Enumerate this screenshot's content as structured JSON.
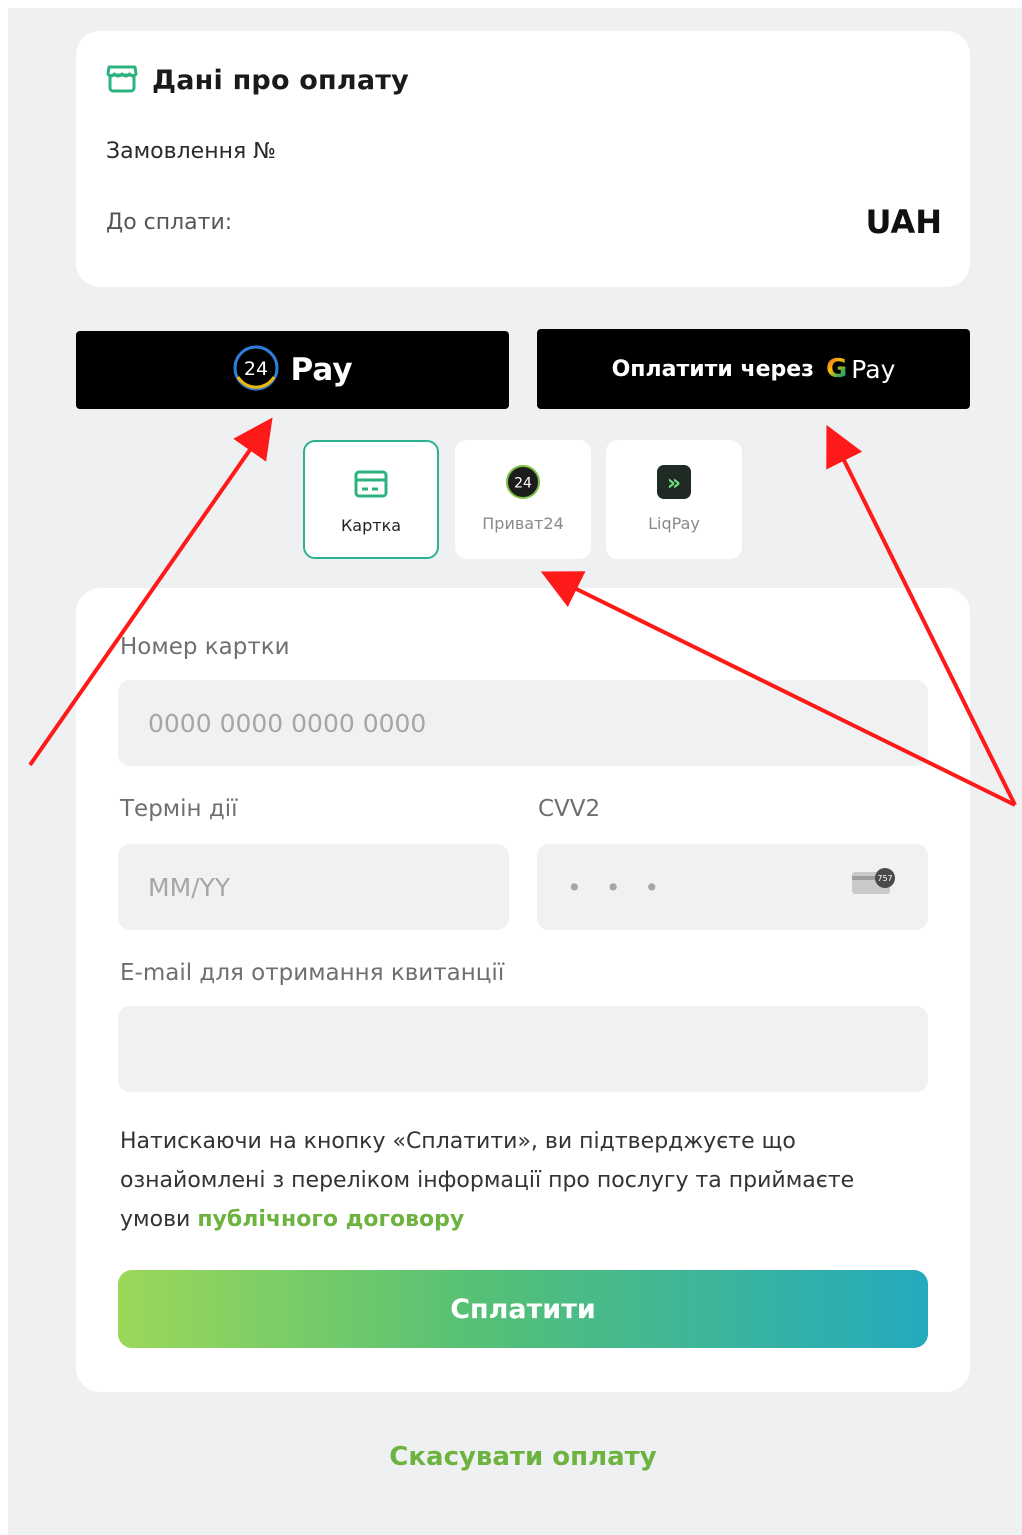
{
  "payment_info": {
    "title": "Дані про оплату",
    "order_label": "Замовлення №",
    "amount_label": "До сплати:",
    "currency": "UAH"
  },
  "quick_pay": {
    "pay24_badge": "24",
    "pay24_label": "Pay",
    "gpay_prefix": "Оплатити через",
    "gpay_g": "G",
    "gpay_label": "Pay"
  },
  "methods": [
    {
      "label": "Картка",
      "icon": "card-icon",
      "active": true
    },
    {
      "label": "Приват24",
      "icon": "privat24-icon",
      "badge": "24",
      "active": false
    },
    {
      "label": "LiqPay",
      "icon": "liqpay-icon",
      "badge": "»",
      "active": false
    }
  ],
  "form": {
    "card_number_label": "Номер картки",
    "card_number_placeholder": "0000 0000 0000 0000",
    "expiry_label": "Термін дії",
    "expiry_placeholder": "MM/YY",
    "cvv_label": "CVV2",
    "cvv_placeholder": "• • •",
    "cvv_hint_text": "757",
    "email_label": "E-mail для отримання квитанції",
    "email_placeholder": "",
    "consent_text": "Натискаючи на кнопку «Сплатити», ви підтверджуєте що ознайомлені з переліком інформації про послугу та приймаєте умови",
    "consent_link": "публічного договору",
    "submit_label": "Сплатити"
  },
  "cancel_label": "Скасувати оплату",
  "colors": {
    "accent_green": "#6cb33f",
    "active_tab_border": "#2cb191",
    "annotation_arrow": "#ff1a1a",
    "page_bg": "#eff0f2"
  }
}
